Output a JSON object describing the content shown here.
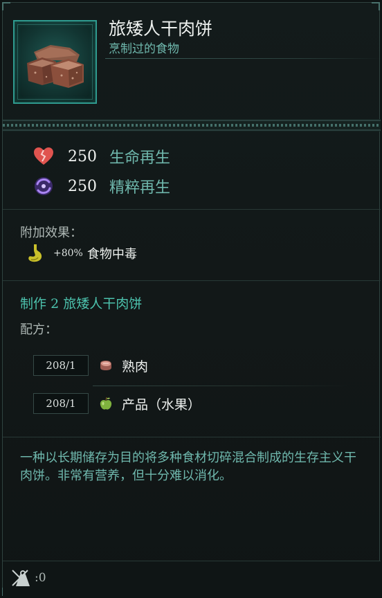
{
  "item": {
    "name": "旅矮人干肉饼",
    "subtitle": "烹制过的食物",
    "icon": "jerky-meat-icon"
  },
  "stats": [
    {
      "icon": "broken-heart-icon",
      "value": "250",
      "label": "生命再生",
      "color": "#e0544f"
    },
    {
      "icon": "essence-swirl-icon",
      "value": "250",
      "label": "精粹再生",
      "color": "#8c63d8"
    }
  ],
  "effects": {
    "label": "附加效果：",
    "items": [
      {
        "icon": "stomach-icon",
        "value": "+80%",
        "text": "食物中毒"
      }
    ]
  },
  "crafting": {
    "prefix": "制作",
    "count": "2",
    "item_name": "旅矮人干肉饼",
    "recipe_label": "配方：",
    "ingredients": [
      {
        "qty": "208/1",
        "icon": "cooked-meat-icon",
        "name": "熟肉"
      },
      {
        "qty": "208/1",
        "icon": "green-apple-icon",
        "name": "产品（水果）"
      }
    ]
  },
  "description": "一种以长期储存为目的将多种食材切碎混合制成的生存主义干肉饼。非常有营养，但十分难以消化。",
  "footer": {
    "weight_icon": "weight-scale-icon",
    "weight_value": ":0"
  },
  "colors": {
    "accent_teal": "#4cc2ad",
    "subtitle_teal": "#6fb8ad",
    "frame_teal": "#2f9c90",
    "background": "#121818"
  }
}
